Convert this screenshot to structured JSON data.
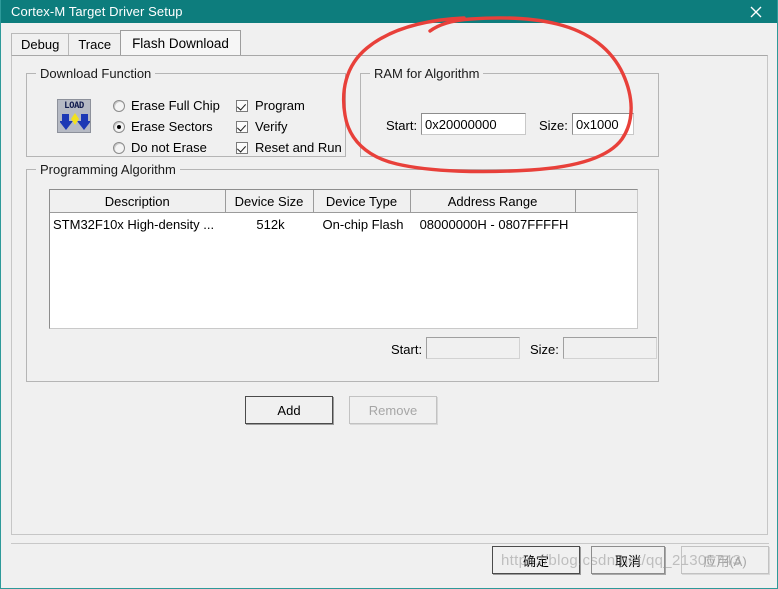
{
  "window": {
    "title": "Cortex-M Target Driver Setup",
    "close_icon": "close-icon",
    "titlebar_color": "#0d7d7d",
    "background_color": "#f0f0f0"
  },
  "tabs": [
    {
      "label": "Debug",
      "active": false
    },
    {
      "label": "Trace",
      "active": false
    },
    {
      "label": "Flash Download",
      "active": true
    }
  ],
  "download_function": {
    "legend": "Download Function",
    "icon_label": "LOAD",
    "erase_options": [
      {
        "label": "Erase Full Chip",
        "selected": false
      },
      {
        "label": "Erase Sectors",
        "selected": true
      },
      {
        "label": "Do not Erase",
        "selected": false
      }
    ],
    "checkboxes": [
      {
        "label": "Program",
        "checked": true
      },
      {
        "label": "Verify",
        "checked": true
      },
      {
        "label": "Reset and Run",
        "checked": true
      }
    ]
  },
  "ram_for_algorithm": {
    "legend": "RAM for Algorithm",
    "start_label": "Start:",
    "start_value": "0x20000000",
    "size_label": "Size:",
    "size_value": "0x1000"
  },
  "programming_algorithm": {
    "legend": "Programming Algorithm",
    "columns": [
      "Description",
      "Device Size",
      "Device Type",
      "Address Range",
      ""
    ],
    "rows": [
      {
        "description": "STM32F10x High-density ...",
        "device_size": "512k",
        "device_type": "On-chip Flash",
        "address_range": "08000000H - 0807FFFFH",
        "extra": ""
      }
    ],
    "start_label": "Start:",
    "start_value": "",
    "size_label": "Size:",
    "size_value": "",
    "add_label": "Add",
    "remove_label": "Remove"
  },
  "footer": {
    "ok_label": "确定",
    "cancel_label": "取消",
    "apply_label": "应用(A)"
  },
  "annotation": {
    "color": "#e8403a",
    "shape": "hand-drawn-ellipse-around-ram-for-algorithm"
  },
  "watermark": {
    "text": "https://blog.csdn.net/qq_21305743"
  }
}
